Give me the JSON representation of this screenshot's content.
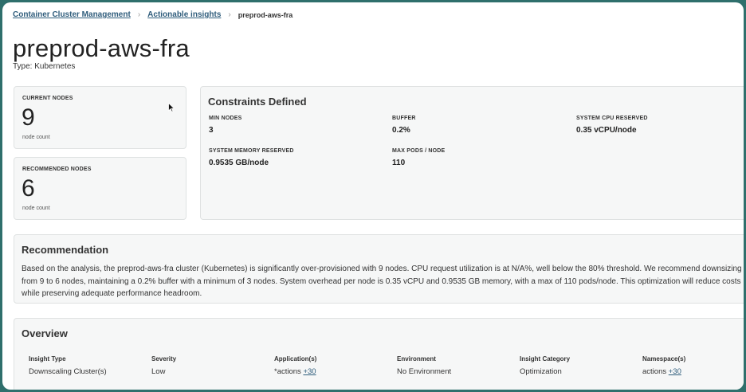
{
  "breadcrumb": {
    "items": [
      "Container Cluster Management",
      "Actionable insights"
    ],
    "separator": "›",
    "current": "preprod-aws-fra"
  },
  "page": {
    "title": "preprod-aws-fra",
    "subtitle": "Type: Kubernetes"
  },
  "current_nodes": {
    "label": "CURRENT NODES",
    "value": "9",
    "note": "node count"
  },
  "recommended_nodes": {
    "label": "RECOMMENDED NODES",
    "value": "6",
    "note": "node count"
  },
  "constraints": {
    "title": "Constraints Defined",
    "items": [
      {
        "label": "MIN NODES",
        "value": "3"
      },
      {
        "label": "BUFFER",
        "value": "0.2%"
      },
      {
        "label": "SYSTEM CPU RESERVED",
        "value": "0.35 vCPU/node"
      },
      {
        "label": "SYSTEM MEMORY RESERVED",
        "value": "0.9535 GB/node"
      },
      {
        "label": "MAX PODS / NODE",
        "value": "110"
      }
    ]
  },
  "recommendation": {
    "title": "Recommendation",
    "text": "Based on the analysis, the preprod-aws-fra cluster (Kubernetes) is significantly over-provisioned with 9 nodes. CPU request utilization is at N/A%, well below the 80% threshold. We recommend downsizing from 9 to 6 nodes, maintaining a 0.2% buffer with a minimum of 3 nodes. System overhead per node is 0.35 vCPU and 0.9535 GB memory, with a max of 110 pods/node. This optimization will reduce costs while preserving adequate performance headroom."
  },
  "overview": {
    "title": "Overview",
    "columns": [
      {
        "header": "Insight Type",
        "value": "Downscaling Cluster(s)",
        "more": ""
      },
      {
        "header": "Severity",
        "value": "Low",
        "more": ""
      },
      {
        "header": "Application(s)",
        "value": "*actions",
        "more": "+30"
      },
      {
        "header": "Environment",
        "value": "No Environment",
        "more": ""
      },
      {
        "header": "Insight Category",
        "value": "Optimization",
        "more": ""
      },
      {
        "header": "Namespace(s)",
        "value": "actions",
        "more": "+30"
      }
    ]
  }
}
